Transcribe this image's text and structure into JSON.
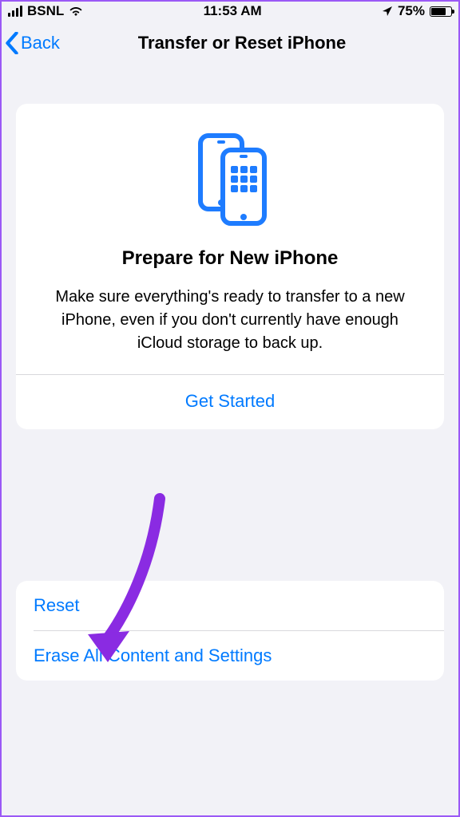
{
  "status": {
    "carrier": "BSNL",
    "time": "11:53 AM",
    "battery_pct": "75%",
    "battery_level": 75
  },
  "nav": {
    "back_label": "Back",
    "title": "Transfer or Reset iPhone"
  },
  "prepare_card": {
    "heading": "Prepare for New iPhone",
    "description": "Make sure everything's ready to transfer to a new iPhone, even if you don't currently have enough iCloud storage to back up.",
    "cta": "Get Started"
  },
  "options": {
    "reset": "Reset",
    "erase": "Erase All Content and Settings"
  },
  "colors": {
    "accent": "#007aff",
    "annotation": "#8a2be2"
  }
}
